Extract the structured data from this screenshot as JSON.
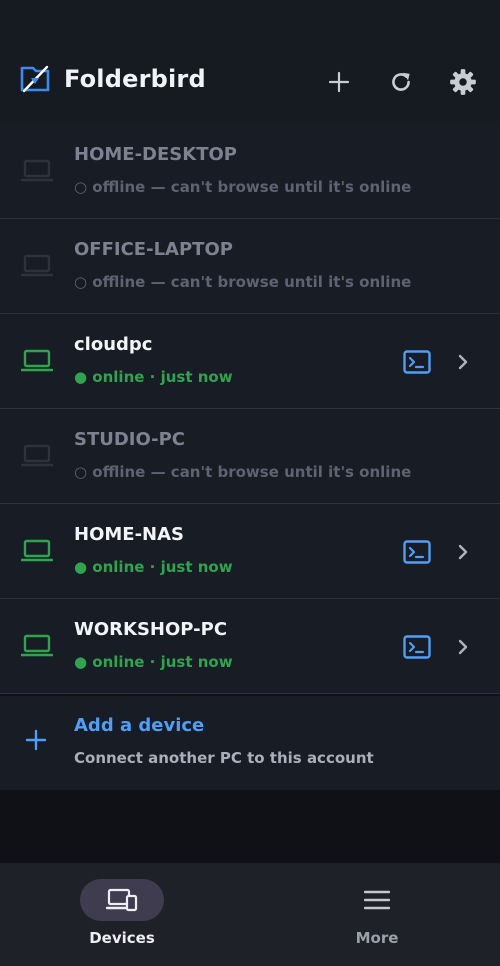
{
  "header": {
    "app_title": "Folderbird",
    "logo_icon": "folderbird-logo-icon",
    "actions": [
      {
        "name": "add-button",
        "icon": "plus-icon"
      },
      {
        "name": "refresh-button",
        "icon": "refresh-icon"
      },
      {
        "name": "settings-button",
        "icon": "gear-icon"
      }
    ]
  },
  "devices": [
    {
      "name": "HOME-DESKTOP",
      "status": "○ offline — can't browse until it's online",
      "online": false
    },
    {
      "name": "OFFICE-LAPTOP",
      "status": "○ offline — can't browse until it's online",
      "online": false
    },
    {
      "name": "cloudpc",
      "status": "● online · just now",
      "online": true
    },
    {
      "name": "STUDIO-PC",
      "status": "○ offline — can't browse until it's online",
      "online": false
    },
    {
      "name": "HOME-NAS",
      "status": "● online · just now",
      "online": true
    },
    {
      "name": "WORKSHOP-PC",
      "status": "● online · just now",
      "online": true
    }
  ],
  "add_device": {
    "title": "Add a device",
    "subtitle": "Connect another PC to this account"
  },
  "bottom_nav": {
    "devices_label": "Devices",
    "more_label": "More",
    "active": "Devices"
  },
  "colors": {
    "online": "#2ea44f",
    "accent_blue": "#4f9ef8",
    "offline_text": "#5d6370",
    "background": "#0f1116"
  }
}
